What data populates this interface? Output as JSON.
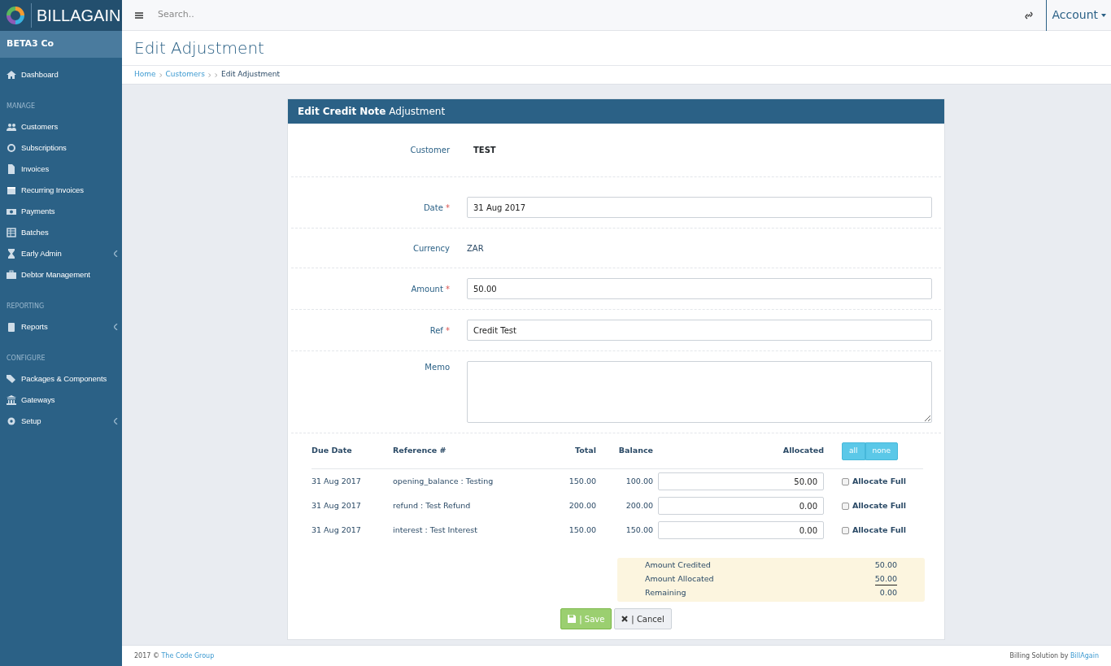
{
  "brand": {
    "name": "BILLAGAIN"
  },
  "topbar": {
    "search_placeholder": "Search..",
    "account": "Account"
  },
  "sidebar": {
    "company": "BETA3 Co",
    "sections": [
      {
        "items": [
          {
            "label": "Dashboard",
            "expandable": false
          }
        ]
      },
      {
        "heading": "MANAGE",
        "items": [
          {
            "label": "Customers",
            "expandable": false
          },
          {
            "label": "Subscriptions",
            "expandable": false
          },
          {
            "label": "Invoices",
            "expandable": false
          },
          {
            "label": "Recurring Invoices",
            "expandable": false
          },
          {
            "label": "Payments",
            "expandable": false
          },
          {
            "label": "Batches",
            "expandable": false
          },
          {
            "label": "Early Admin",
            "expandable": true
          },
          {
            "label": "Debtor Management",
            "expandable": false
          }
        ]
      },
      {
        "heading": "REPORTING",
        "items": [
          {
            "label": "Reports",
            "expandable": true
          }
        ]
      },
      {
        "heading": "CONFIGURE",
        "items": [
          {
            "label": "Packages & Components",
            "expandable": false
          },
          {
            "label": "Gateways",
            "expandable": false
          },
          {
            "label": "Setup",
            "expandable": true
          }
        ]
      }
    ]
  },
  "page": {
    "title": "Edit Adjustment",
    "breadcrumb": [
      {
        "kind": "link",
        "label": "Home"
      },
      {
        "kind": "link",
        "label": "Customers"
      },
      {
        "kind": "empty"
      },
      {
        "kind": "current",
        "label": "Edit Adjustment"
      }
    ]
  },
  "card": {
    "title": "**Edit Credit Note** Adjustment",
    "fields": [
      {
        "kind": "static",
        "label": "Customer",
        "value": "TEST"
      },
      {
        "kind": "input",
        "label": "Date",
        "value": "31 Aug 2017",
        "required_mark": "*"
      },
      {
        "kind": "text",
        "label": "Currency",
        "value": "ZAR"
      },
      {
        "kind": "input",
        "label": "Amount",
        "value": "50.00",
        "required_mark": "*"
      },
      {
        "kind": "input",
        "label": "Ref",
        "value": "Credit Test",
        "required_mark": "*"
      },
      {
        "kind": "textarea",
        "label": "Memo"
      }
    ],
    "table": {
      "columns": [
        "Due Date",
        "Reference #",
        "Total",
        "Balance",
        "Allocated"
      ],
      "select_buttons": [
        "all",
        "none"
      ],
      "rows": [
        {
          "due_date": "31 Aug 2017",
          "reference": "opening_balance : Testing",
          "total": "150.00",
          "balance": "100.00",
          "allocated": "50.00",
          "allocate_full": "Allocate Full",
          "checked": false
        },
        {
          "due_date": "31 Aug 2017",
          "reference": "refund : Test Refund",
          "total": "200.00",
          "balance": "200.00",
          "allocated": "0.00",
          "allocate_full": "Allocate Full",
          "checked": false
        },
        {
          "due_date": "31 Aug 2017",
          "reference": "interest : Test Interest",
          "total": "150.00",
          "balance": "150.00",
          "allocated": "0.00",
          "allocate_full": "Allocate Full",
          "checked": false
        }
      ]
    },
    "summary": [
      {
        "label": "Amount Credited",
        "value": "50.00",
        "underlined": false
      },
      {
        "label": "Amount Allocated",
        "value": "50.00",
        "underlined": true
      },
      {
        "label": "Remaining",
        "value": "0.00",
        "underlined": false
      }
    ],
    "buttons": [
      {
        "kind": "save",
        "label": "| Save"
      },
      {
        "kind": "cancel",
        "label": "| Cancel"
      }
    ]
  },
  "footer": {
    "copyright": "2017 ©",
    "company": "The Code Group",
    "credit": "Billing Solution by",
    "credit_link": "BillAgain"
  }
}
